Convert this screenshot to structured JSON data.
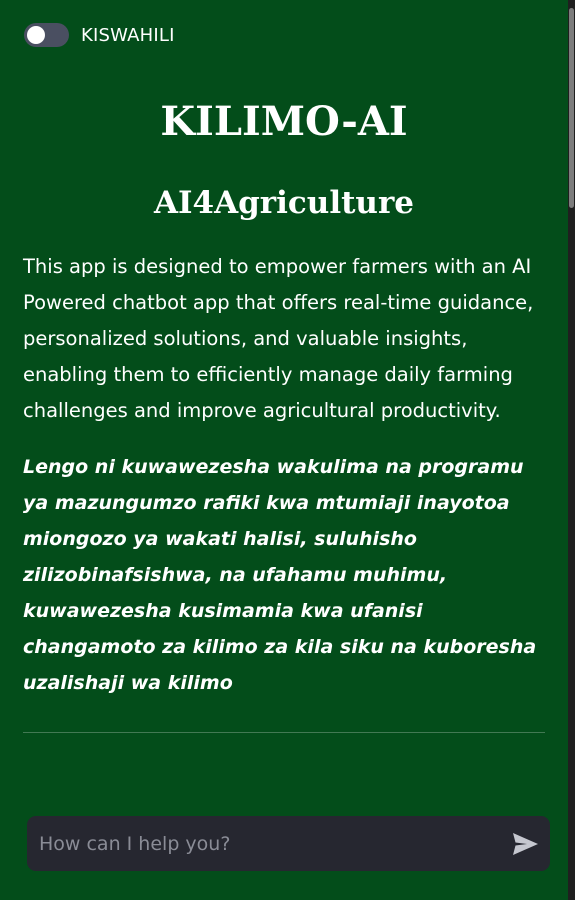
{
  "language_toggle": {
    "label": "KISWAHILI",
    "checked": false
  },
  "header": {
    "title": "KILIMO-AI",
    "subtitle": "AI4Agriculture"
  },
  "content": {
    "description_en": "This app is designed to empower farmers with an AI Powered chatbot app that offers real-time guidance, personalized solutions, and valuable insights, enabling them to efficiently manage daily farming challenges and improve agricultural productivity.",
    "description_sw": "Lengo ni kuwawezesha wakulima na programu ya mazungumzo rafiki kwa mtumiaji inayotoa miongozo ya wakati halisi, suluhisho zilizobinafsishwa, na ufahamu muhimu, kuwawezesha kusimamia kwa ufanisi changamoto za kilimo za kila siku na kuboresha uzalishaji wa kilimo"
  },
  "chat": {
    "input_value": "",
    "placeholder": "How can I help you?",
    "send_icon": "send-icon"
  },
  "colors": {
    "background": "#034d1a",
    "chat_bar": "#262730",
    "toggle_track": "#4a4f61",
    "text": "#ffffff",
    "placeholder": "#8a8c96"
  }
}
